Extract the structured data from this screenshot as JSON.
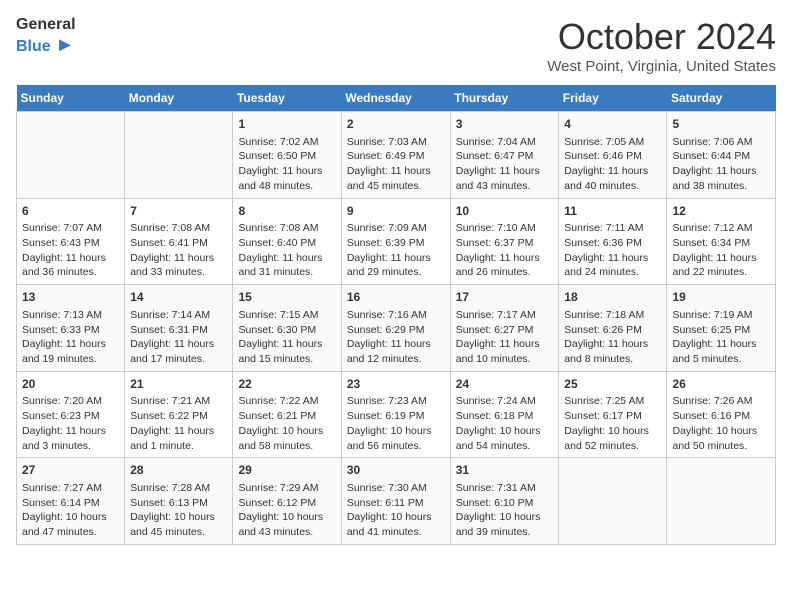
{
  "header": {
    "logo_line1": "General",
    "logo_line2": "Blue",
    "title": "October 2024",
    "location": "West Point, Virginia, United States"
  },
  "days_of_week": [
    "Sunday",
    "Monday",
    "Tuesday",
    "Wednesday",
    "Thursday",
    "Friday",
    "Saturday"
  ],
  "weeks": [
    [
      {
        "day": "",
        "content": ""
      },
      {
        "day": "",
        "content": ""
      },
      {
        "day": "1",
        "content": "Sunrise: 7:02 AM\nSunset: 6:50 PM\nDaylight: 11 hours and 48 minutes."
      },
      {
        "day": "2",
        "content": "Sunrise: 7:03 AM\nSunset: 6:49 PM\nDaylight: 11 hours and 45 minutes."
      },
      {
        "day": "3",
        "content": "Sunrise: 7:04 AM\nSunset: 6:47 PM\nDaylight: 11 hours and 43 minutes."
      },
      {
        "day": "4",
        "content": "Sunrise: 7:05 AM\nSunset: 6:46 PM\nDaylight: 11 hours and 40 minutes."
      },
      {
        "day": "5",
        "content": "Sunrise: 7:06 AM\nSunset: 6:44 PM\nDaylight: 11 hours and 38 minutes."
      }
    ],
    [
      {
        "day": "6",
        "content": "Sunrise: 7:07 AM\nSunset: 6:43 PM\nDaylight: 11 hours and 36 minutes."
      },
      {
        "day": "7",
        "content": "Sunrise: 7:08 AM\nSunset: 6:41 PM\nDaylight: 11 hours and 33 minutes."
      },
      {
        "day": "8",
        "content": "Sunrise: 7:08 AM\nSunset: 6:40 PM\nDaylight: 11 hours and 31 minutes."
      },
      {
        "day": "9",
        "content": "Sunrise: 7:09 AM\nSunset: 6:39 PM\nDaylight: 11 hours and 29 minutes."
      },
      {
        "day": "10",
        "content": "Sunrise: 7:10 AM\nSunset: 6:37 PM\nDaylight: 11 hours and 26 minutes."
      },
      {
        "day": "11",
        "content": "Sunrise: 7:11 AM\nSunset: 6:36 PM\nDaylight: 11 hours and 24 minutes."
      },
      {
        "day": "12",
        "content": "Sunrise: 7:12 AM\nSunset: 6:34 PM\nDaylight: 11 hours and 22 minutes."
      }
    ],
    [
      {
        "day": "13",
        "content": "Sunrise: 7:13 AM\nSunset: 6:33 PM\nDaylight: 11 hours and 19 minutes."
      },
      {
        "day": "14",
        "content": "Sunrise: 7:14 AM\nSunset: 6:31 PM\nDaylight: 11 hours and 17 minutes."
      },
      {
        "day": "15",
        "content": "Sunrise: 7:15 AM\nSunset: 6:30 PM\nDaylight: 11 hours and 15 minutes."
      },
      {
        "day": "16",
        "content": "Sunrise: 7:16 AM\nSunset: 6:29 PM\nDaylight: 11 hours and 12 minutes."
      },
      {
        "day": "17",
        "content": "Sunrise: 7:17 AM\nSunset: 6:27 PM\nDaylight: 11 hours and 10 minutes."
      },
      {
        "day": "18",
        "content": "Sunrise: 7:18 AM\nSunset: 6:26 PM\nDaylight: 11 hours and 8 minutes."
      },
      {
        "day": "19",
        "content": "Sunrise: 7:19 AM\nSunset: 6:25 PM\nDaylight: 11 hours and 5 minutes."
      }
    ],
    [
      {
        "day": "20",
        "content": "Sunrise: 7:20 AM\nSunset: 6:23 PM\nDaylight: 11 hours and 3 minutes."
      },
      {
        "day": "21",
        "content": "Sunrise: 7:21 AM\nSunset: 6:22 PM\nDaylight: 11 hours and 1 minute."
      },
      {
        "day": "22",
        "content": "Sunrise: 7:22 AM\nSunset: 6:21 PM\nDaylight: 10 hours and 58 minutes."
      },
      {
        "day": "23",
        "content": "Sunrise: 7:23 AM\nSunset: 6:19 PM\nDaylight: 10 hours and 56 minutes."
      },
      {
        "day": "24",
        "content": "Sunrise: 7:24 AM\nSunset: 6:18 PM\nDaylight: 10 hours and 54 minutes."
      },
      {
        "day": "25",
        "content": "Sunrise: 7:25 AM\nSunset: 6:17 PM\nDaylight: 10 hours and 52 minutes."
      },
      {
        "day": "26",
        "content": "Sunrise: 7:26 AM\nSunset: 6:16 PM\nDaylight: 10 hours and 50 minutes."
      }
    ],
    [
      {
        "day": "27",
        "content": "Sunrise: 7:27 AM\nSunset: 6:14 PM\nDaylight: 10 hours and 47 minutes."
      },
      {
        "day": "28",
        "content": "Sunrise: 7:28 AM\nSunset: 6:13 PM\nDaylight: 10 hours and 45 minutes."
      },
      {
        "day": "29",
        "content": "Sunrise: 7:29 AM\nSunset: 6:12 PM\nDaylight: 10 hours and 43 minutes."
      },
      {
        "day": "30",
        "content": "Sunrise: 7:30 AM\nSunset: 6:11 PM\nDaylight: 10 hours and 41 minutes."
      },
      {
        "day": "31",
        "content": "Sunrise: 7:31 AM\nSunset: 6:10 PM\nDaylight: 10 hours and 39 minutes."
      },
      {
        "day": "",
        "content": ""
      },
      {
        "day": "",
        "content": ""
      }
    ]
  ]
}
